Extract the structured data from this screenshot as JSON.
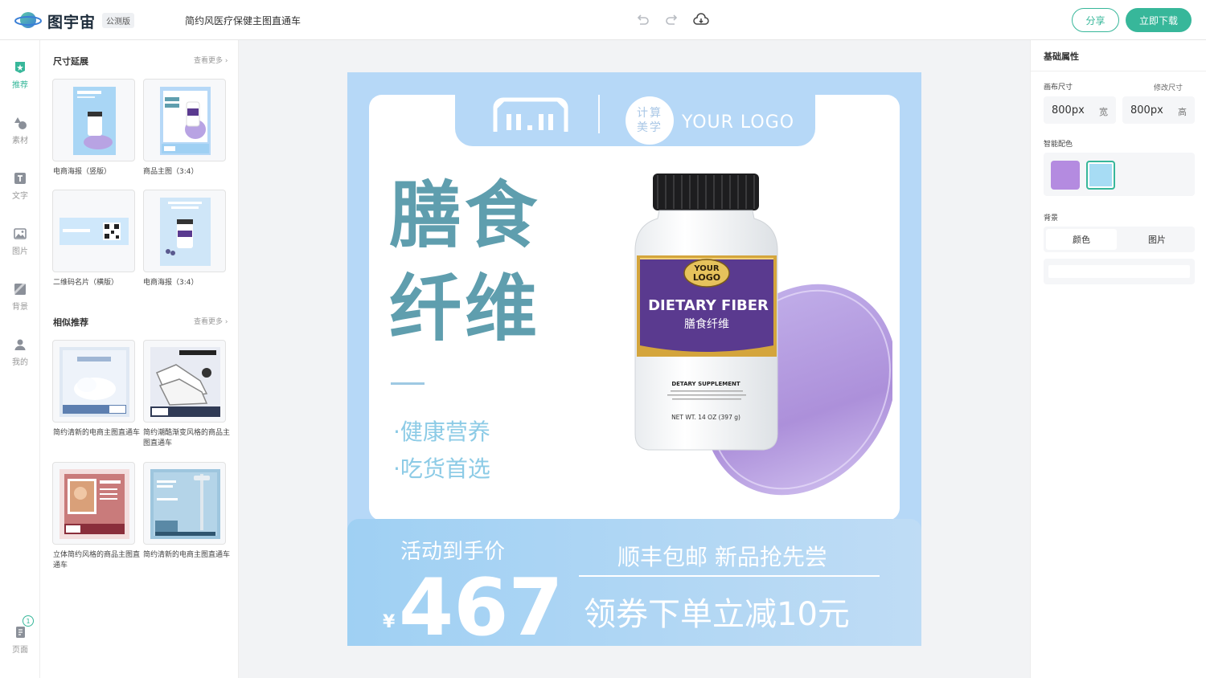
{
  "app": {
    "name": "图宇宙",
    "badge": "公测版",
    "doc_title": "简约风医疗保健主图直通车"
  },
  "topbar": {
    "undo_icon": "undo-icon",
    "redo_icon": "redo-icon",
    "cloud_icon": "cloud-save-icon",
    "share_label": "分享",
    "download_label": "立即下载"
  },
  "nav": {
    "items": [
      {
        "label": "推荐",
        "icon": "recommend-icon",
        "active": true
      },
      {
        "label": "素材",
        "icon": "shapes-icon"
      },
      {
        "label": "文字",
        "icon": "text-icon"
      },
      {
        "label": "图片",
        "icon": "image-icon"
      },
      {
        "label": "背景",
        "icon": "background-icon"
      },
      {
        "label": "我的",
        "icon": "user-icon"
      }
    ],
    "pages_label": "页面",
    "pages_count": "1"
  },
  "templates": {
    "size_section": {
      "title": "尺寸延展",
      "more": "查看更多",
      "items": [
        {
          "label": "电商海报（竖版）"
        },
        {
          "label": "商品主图（3:4）"
        },
        {
          "label": "二维码名片（横版）"
        },
        {
          "label": "电商海报（3:4）"
        }
      ]
    },
    "similar_section": {
      "title": "相似推荐",
      "more": "查看更多",
      "items": [
        {
          "label": "简约清新的电商主图直通车"
        },
        {
          "label": "简约潮酷渐变风格的商品主图直通车"
        },
        {
          "label": "立体简约风格的商品主图直通车"
        },
        {
          "label": "简约清新的电商主图直通车"
        }
      ]
    }
  },
  "canvas": {
    "logo_text": "YOUR LOGO",
    "logo_circle_top": "计算",
    "logo_circle_bottom": "美学",
    "mall_logo": "11.11",
    "headline_line1": "膳食",
    "headline_line2": "纤维",
    "bullet1": "·健康营养",
    "bullet2": "·吃货首选",
    "product": {
      "badge_top": "YOUR",
      "badge_bottom": "LOGO",
      "name_en": "DIETARY FIBER",
      "name_cn": "膳食纤维",
      "supplement": "DETARY SUPPLEMENT",
      "weight": "NET WT. 14 OZ (397 g)"
    },
    "promo_label": "活动到手价",
    "currency": "¥",
    "price": "467",
    "shipping": "顺丰包邮 新品抢先尝",
    "coupon": "领券下单立减10元",
    "colors": {
      "bg": "#b6d8f7",
      "headline": "#5f9eae",
      "accent": "#8ccbe6",
      "purple": "#5a3a8f"
    }
  },
  "props": {
    "title": "基础属性",
    "canvas_size_label": "画布尺寸",
    "resize_link": "修改尺寸",
    "width_value": "800px",
    "width_unit": "宽",
    "height_value": "800px",
    "height_unit": "高",
    "palette_label": "智能配色",
    "palette": [
      "#b48be0",
      "#a7dcf4"
    ],
    "background_label": "背景",
    "bg_tab_color": "颜色",
    "bg_tab_image": "图片"
  }
}
